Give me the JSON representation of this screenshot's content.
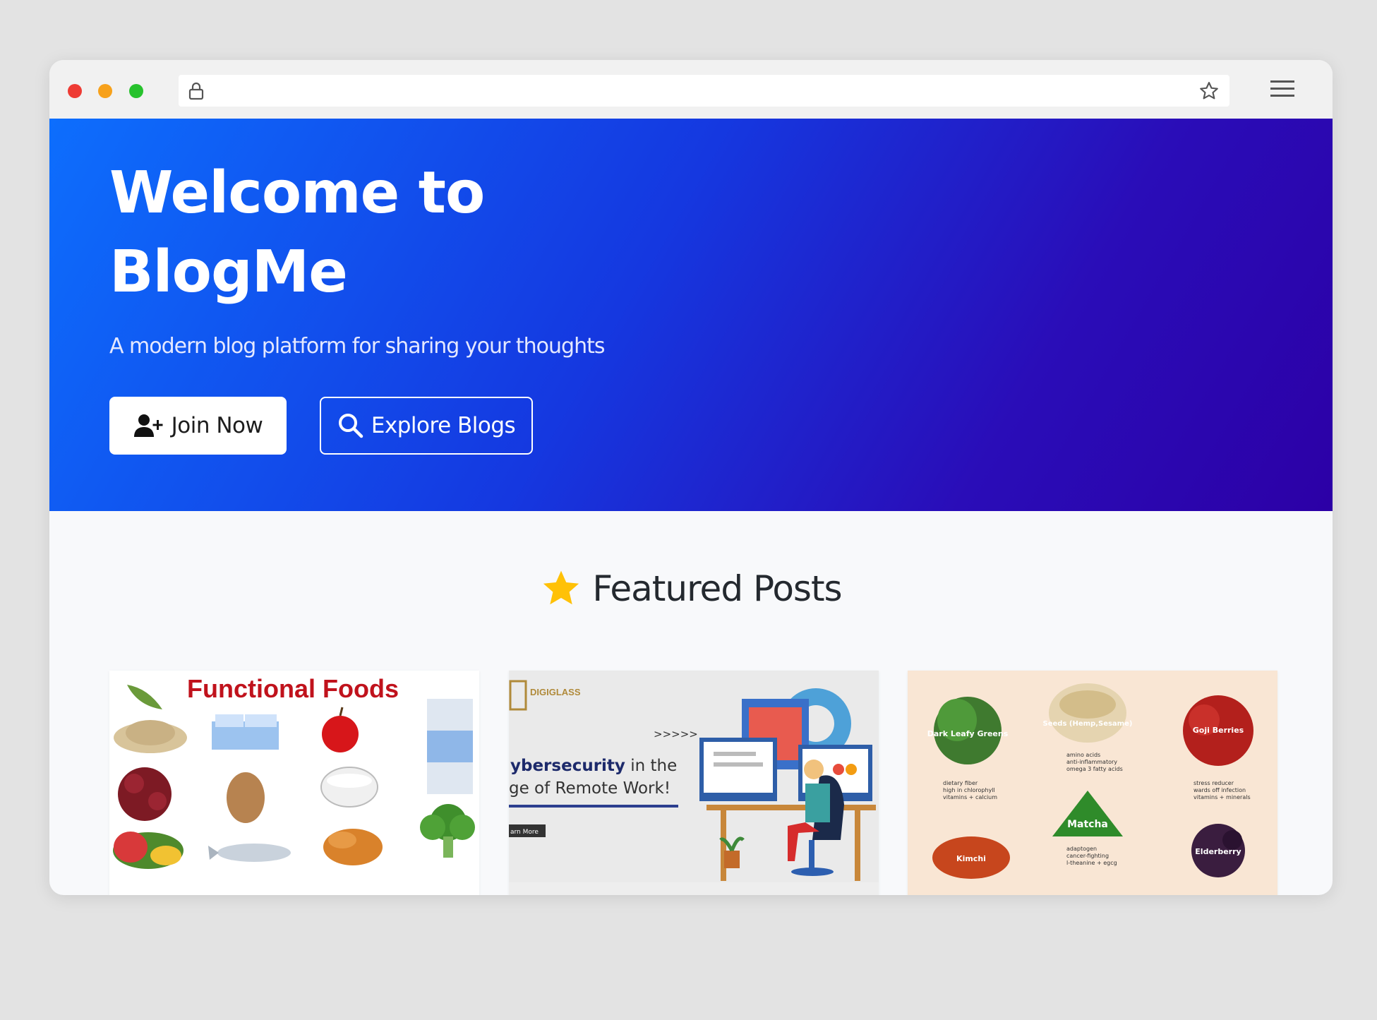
{
  "browser": {
    "icons": {
      "lock": "lock-icon",
      "bookmark": "star-outline-icon",
      "menu": "hamburger-menu-icon"
    }
  },
  "hero": {
    "title_line1": "Welcome to",
    "title_line2": "BlogMe",
    "subtitle": "A modern blog platform for sharing your thoughts",
    "join_label": "Join Now",
    "explore_label": "Explore Blogs"
  },
  "featured": {
    "title": "Featured Posts",
    "cards": [
      {
        "image_text": "Functional Foods"
      },
      {
        "image_brand": "DIGIGLASS",
        "image_line1_bold": "ybersecurity",
        "image_line1_rest": " in the",
        "image_line2": "ge of Remote Work!",
        "image_button": "arn More",
        "image_arrows": ">>>>>"
      },
      {
        "labels": [
          "Dark Leafy Greens",
          "Seeds (Hemp,Sesame)",
          "Goji Berries",
          "Matcha",
          "Kimchi",
          "Elderberry"
        ],
        "bullets_1": [
          "dietary fiber",
          "high in chlorophyll",
          "vitamins + calcium"
        ],
        "bullets_2": [
          "amino acids",
          "anti-inflammatory",
          "omega 3 fatty acids"
        ],
        "bullets_3": [
          "stress reducer",
          "wards off infection",
          "vitamins + minerals"
        ],
        "bullets_4": [
          "adaptogen",
          "cancer-fighting",
          "l-theanine + egcg"
        ]
      }
    ]
  },
  "colors": {
    "hero_start": "#0d6efd",
    "hero_end": "#2c00a6",
    "star": "#ffc107"
  }
}
